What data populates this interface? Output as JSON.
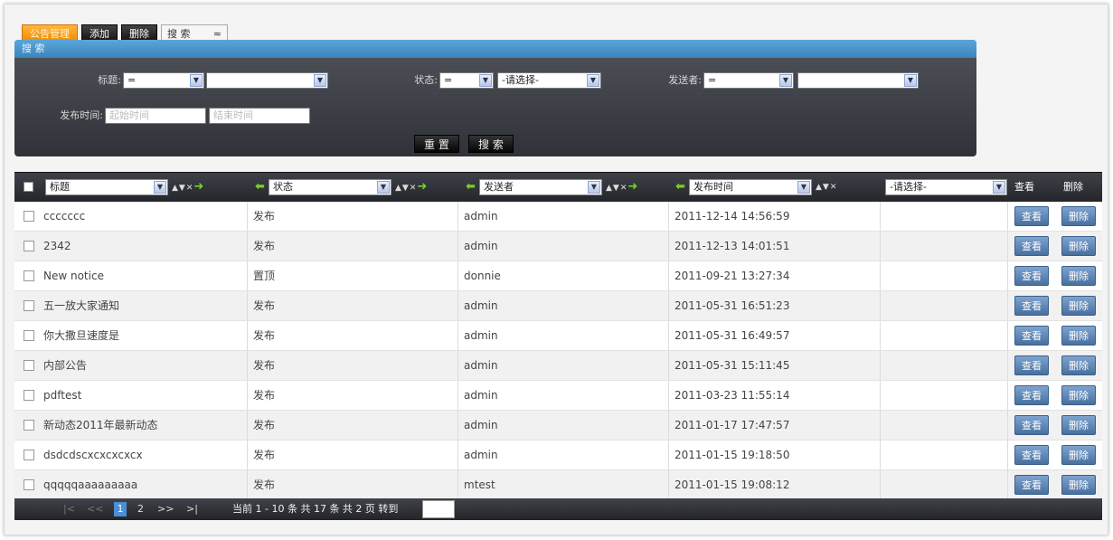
{
  "toolbar": {
    "manage_label": "公告管理",
    "add_label": "添加",
    "delete_label": "删除",
    "search_label": "搜 索",
    "search_toggle": "≈"
  },
  "search_panel": {
    "title": "搜 索",
    "title_label": "标题:",
    "title_op": "=",
    "title_value": "",
    "status_label": "状态:",
    "status_op": "=",
    "status_value": "-请选择-",
    "sender_label": "发送者:",
    "sender_op": "=",
    "sender_value": "",
    "time_label": "发布时间:",
    "start_placeholder": "起始时间",
    "end_placeholder": "结束时间",
    "reset_label": "重 置",
    "search_label": "搜 索"
  },
  "table": {
    "columns": {
      "title": "标题",
      "status": "状态",
      "sender": "发送者",
      "time": "发布时间",
      "extra": "-请选择-",
      "view": "查看",
      "delete": "删除"
    },
    "sort_controls": "▲▼✕",
    "rows": [
      {
        "title": "ccccccc",
        "status": "发布",
        "sender": "admin",
        "time": "2011-12-14 14:56:59",
        "view": "查看",
        "delete": "删除"
      },
      {
        "title": "2342",
        "status": "发布",
        "sender": "admin",
        "time": "2011-12-13 14:01:51",
        "view": "查看",
        "delete": "删除"
      },
      {
        "title": "New notice",
        "status": "置顶",
        "sender": "donnie",
        "time": "2011-09-21 13:27:34",
        "view": "查看",
        "delete": "删除"
      },
      {
        "title": "五一放大家通知",
        "status": "发布",
        "sender": "admin",
        "time": "2011-05-31 16:51:23",
        "view": "查看",
        "delete": "删除"
      },
      {
        "title": "你大撒旦速度是",
        "status": "发布",
        "sender": "admin",
        "time": "2011-05-31 16:49:57",
        "view": "查看",
        "delete": "删除"
      },
      {
        "title": "内部公告",
        "status": "发布",
        "sender": "admin",
        "time": "2011-05-31 15:11:45",
        "view": "查看",
        "delete": "删除"
      },
      {
        "title": "pdftest",
        "status": "发布",
        "sender": "admin",
        "time": "2011-03-23 11:55:14",
        "view": "查看",
        "delete": "删除"
      },
      {
        "title": "新动态2011年最新动态",
        "status": "发布",
        "sender": "admin",
        "time": "2011-01-17 17:47:57",
        "view": "查看",
        "delete": "删除"
      },
      {
        "title": "dsdcdscxcxcxcxcx",
        "status": "发布",
        "sender": "admin",
        "time": "2011-01-15 19:18:50",
        "view": "查看",
        "delete": "删除"
      },
      {
        "title": "qqqqqaaaaaaaaa",
        "status": "发布",
        "sender": "mtest",
        "time": "2011-01-15 19:08:12",
        "view": "查看",
        "delete": "删除"
      }
    ]
  },
  "pager": {
    "first": "|<",
    "prev": "<<",
    "current_page": "1",
    "page2": "2",
    "next": ">>",
    "last": ">|",
    "summary": "当前 1 - 10 条 共 17 条 共 2 页 转到"
  },
  "colors": {
    "accent_orange": "#f08a00",
    "panel_header_blue": "#3b84bd",
    "dark_bar": "#24262b",
    "action_button_blue": "#47709f",
    "pager_current": "#4b8ed2",
    "arrow_green": "#7ccd28"
  }
}
